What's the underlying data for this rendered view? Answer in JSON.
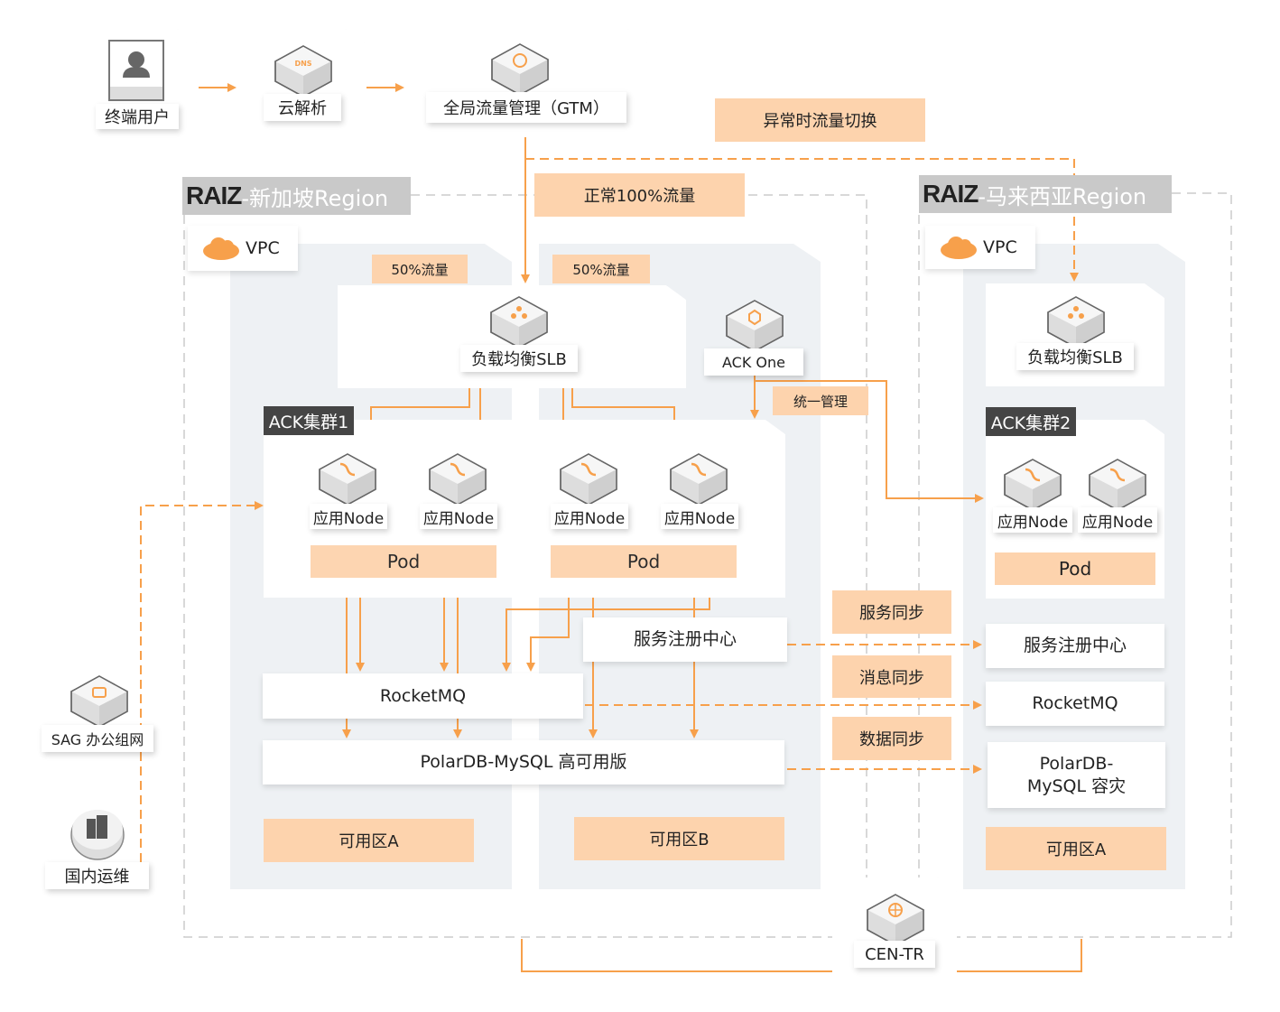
{
  "top": {
    "user": "终端用户",
    "dns": "云解析",
    "gtm": "全局流量管理（GTM）",
    "failover": "异常时流量切换",
    "normal": "正常100%流量"
  },
  "sg": {
    "brand": "RAIZ",
    "region": "-新加坡Region",
    "vpc": "VPC",
    "flow_a": "50%流量",
    "flow_b": "50%流量",
    "slb": "负载均衡SLB",
    "ack_one": "ACK One",
    "unified": "统一管理",
    "cluster": "ACK集群1",
    "nodes": [
      "应用Node",
      "应用Node",
      "应用Node",
      "应用Node"
    ],
    "pod_a": "Pod",
    "pod_b": "Pod",
    "registry": "服务注册中心",
    "mq": "RocketMQ",
    "db": "PolarDB-MySQL 高可用版",
    "zone_a": "可用区A",
    "zone_b": "可用区B"
  },
  "sync": {
    "service": "服务同步",
    "message": "消息同步",
    "data": "数据同步"
  },
  "my": {
    "brand": "RAIZ",
    "region": "-马来西亚Region",
    "vpc": "VPC",
    "slb": "负载均衡SLB",
    "cluster": "ACK集群2",
    "nodes": [
      "应用Node",
      "应用Node"
    ],
    "pod": "Pod",
    "registry": "服务注册中心",
    "mq": "RocketMQ",
    "db": "PolarDB-MySQL 容灾",
    "zone_a": "可用区A"
  },
  "left": {
    "sag": "SAG 办公组网",
    "ops": "国内运维"
  },
  "cen": "CEN-TR",
  "colors": {
    "accent": "#f7a04b",
    "light": "#fdd3ad",
    "zone": "#eef1f4"
  }
}
